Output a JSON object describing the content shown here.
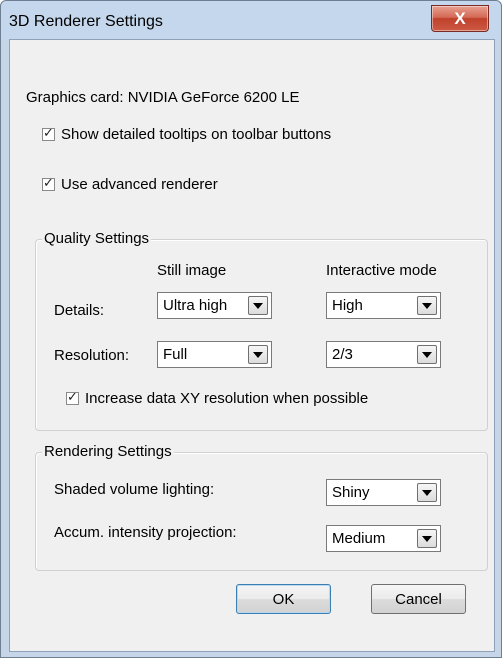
{
  "window": {
    "title": "3D Renderer Settings",
    "close_symbol": "X"
  },
  "graphics_card": "Graphics card: NVIDIA GeForce 6200 LE",
  "options": {
    "tooltips": {
      "label": "Show detailed tooltips on toolbar buttons",
      "checked": true
    },
    "advanced_renderer": {
      "label": "Use advanced renderer",
      "checked": true
    }
  },
  "quality": {
    "title": "Quality Settings",
    "col_still": "Still image",
    "col_interactive": "Interactive mode",
    "details_label": "Details:",
    "details_still": "Ultra high",
    "details_interactive": "High",
    "resolution_label": "Resolution:",
    "resolution_still": "Full",
    "resolution_interactive": "2/3",
    "increase_xy": {
      "label": "Increase data XY resolution when possible",
      "checked": true
    }
  },
  "rendering": {
    "title": "Rendering Settings",
    "shaded_label": "Shaded volume lighting:",
    "shaded_value": "Shiny",
    "accum_label": "Accum. intensity projection:",
    "accum_value": "Medium"
  },
  "buttons": {
    "ok": "OK",
    "cancel": "Cancel"
  },
  "check_glyph": "✓"
}
